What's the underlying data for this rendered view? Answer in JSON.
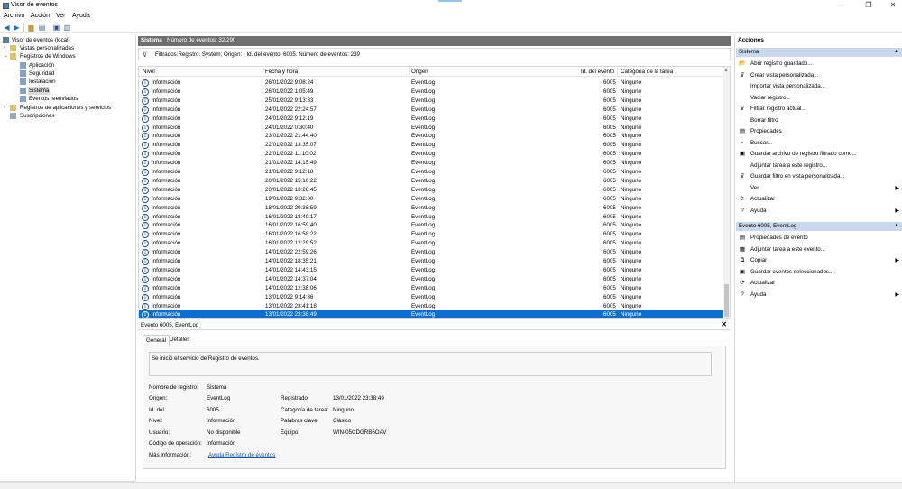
{
  "window": {
    "title": "Visor de eventos"
  },
  "menu": [
    "Archivo",
    "Acción",
    "Ver",
    "Ayuda"
  ],
  "window_controls": {
    "minimize": "—",
    "maximize": "❐",
    "close": "✕"
  },
  "tree": [
    {
      "label": "Visor de eventos (local)",
      "exp": "",
      "icon": "event-viewer-icon"
    },
    {
      "label": "Vistas personalizadas",
      "exp": "›",
      "icon": "folder-icon"
    },
    {
      "label": "Registros de Windows",
      "exp": "⌄",
      "icon": "folder-icon"
    },
    {
      "label": "Aplicación",
      "exp": "",
      "icon": "log-icon"
    },
    {
      "label": "Seguridad",
      "exp": "",
      "icon": "log-icon"
    },
    {
      "label": "Instalación",
      "exp": "",
      "icon": "log-icon"
    },
    {
      "label": "Sistema",
      "exp": "",
      "icon": "log-icon"
    },
    {
      "label": "Eventos reenviados",
      "exp": "",
      "icon": "log-icon"
    },
    {
      "label": "Registros de aplicaciones y servicios",
      "exp": "›",
      "icon": "folder-icon"
    },
    {
      "label": "Suscripciones",
      "exp": "",
      "icon": "subscription-icon"
    }
  ],
  "center": {
    "log_name": "Sistema",
    "event_count": "Número de eventos: 32.290",
    "filter_text": "Filtrados:Registro: System; Origen: ; Id. del evento: 6005. Número de eventos: 239"
  },
  "columns": [
    "Nivel",
    "Fecha y hora",
    "Origen",
    "Id. del evento",
    "Categoría de la tarea"
  ],
  "events": [
    {
      "level": "Información",
      "date": "26/01/2022 9:08:24",
      "source": "EventLog",
      "id": "6005",
      "category": "Ninguno"
    },
    {
      "level": "Información",
      "date": "26/01/2022 1:05:49",
      "source": "EventLog",
      "id": "6005",
      "category": "Ninguno"
    },
    {
      "level": "Información",
      "date": "25/01/2022 9:13:33",
      "source": "EventLog",
      "id": "6005",
      "category": "Ninguno"
    },
    {
      "level": "Información",
      "date": "24/01/2022 22:24:57",
      "source": "EventLog",
      "id": "6005",
      "category": "Ninguno"
    },
    {
      "level": "Información",
      "date": "24/01/2022 9:12:19",
      "source": "EventLog",
      "id": "6005",
      "category": "Ninguno"
    },
    {
      "level": "Información",
      "date": "24/01/2022 0:30:40",
      "source": "EventLog",
      "id": "6005",
      "category": "Ninguno"
    },
    {
      "level": "Información",
      "date": "23/01/2022 21:44:40",
      "source": "EventLog",
      "id": "6005",
      "category": "Ninguno"
    },
    {
      "level": "Información",
      "date": "22/01/2022 13:35:07",
      "source": "EventLog",
      "id": "6005",
      "category": "Ninguno"
    },
    {
      "level": "Información",
      "date": "22/01/2022 11:10:02",
      "source": "EventLog",
      "id": "6005",
      "category": "Ninguno"
    },
    {
      "level": "Información",
      "date": "21/01/2022 14:15:49",
      "source": "EventLog",
      "id": "6005",
      "category": "Ninguno"
    },
    {
      "level": "Información",
      "date": "21/01/2022 9:12:18",
      "source": "EventLog",
      "id": "6005",
      "category": "Ninguno"
    },
    {
      "level": "Información",
      "date": "20/01/2022 15:10:22",
      "source": "EventLog",
      "id": "6005",
      "category": "Ninguno"
    },
    {
      "level": "Información",
      "date": "20/01/2022 13:28:45",
      "source": "EventLog",
      "id": "6005",
      "category": "Ninguno"
    },
    {
      "level": "Información",
      "date": "19/01/2022 9:32:00",
      "source": "EventLog",
      "id": "6005",
      "category": "Ninguno"
    },
    {
      "level": "Información",
      "date": "18/01/2022 20:38:59",
      "source": "EventLog",
      "id": "6005",
      "category": "Ninguno"
    },
    {
      "level": "Información",
      "date": "16/01/2022 18:49:17",
      "source": "EventLog",
      "id": "6005",
      "category": "Ninguno"
    },
    {
      "level": "Información",
      "date": "16/01/2022 16:59:40",
      "source": "EventLog",
      "id": "6005",
      "category": "Ninguno"
    },
    {
      "level": "Información",
      "date": "16/01/2022 16:58:22",
      "source": "EventLog",
      "id": "6005",
      "category": "Ninguno"
    },
    {
      "level": "Información",
      "date": "16/01/2022 12:29:52",
      "source": "EventLog",
      "id": "6005",
      "category": "Ninguno"
    },
    {
      "level": "Información",
      "date": "14/01/2022 22:59:26",
      "source": "EventLog",
      "id": "6005",
      "category": "Ninguno"
    },
    {
      "level": "Información",
      "date": "14/01/2022 18:35:21",
      "source": "EventLog",
      "id": "6005",
      "category": "Ninguno"
    },
    {
      "level": "Información",
      "date": "14/01/2022 14:43:15",
      "source": "EventLog",
      "id": "6005",
      "category": "Ninguno"
    },
    {
      "level": "Información",
      "date": "14/01/2022 14:37:04",
      "source": "EventLog",
      "id": "6005",
      "category": "Ninguno"
    },
    {
      "level": "Información",
      "date": "14/01/2022 12:38:06",
      "source": "EventLog",
      "id": "6005",
      "category": "Ninguno"
    },
    {
      "level": "Información",
      "date": "13/01/2022 9:14:36",
      "source": "EventLog",
      "id": "6005",
      "category": "Ninguno"
    },
    {
      "level": "Información",
      "date": "13/01/2022 23:41:18",
      "source": "EventLog",
      "id": "6005",
      "category": "Ninguno"
    },
    {
      "level": "Información",
      "date": "13/01/2022 23:38:49",
      "source": "EventLog",
      "id": "6005",
      "category": "Ninguno",
      "selected": true
    }
  ],
  "detail": {
    "title": "Evento 6005, EventLog",
    "close": "✕",
    "tabs": [
      "General",
      "Detalles"
    ],
    "description": "Se inició el servicio de Registro de eventos.",
    "fields": {
      "log_name_label": "Nombre de registro:",
      "log_name": "Sistema",
      "source_label": "Origen:",
      "source": "EventLog",
      "logged_label": "Registrado:",
      "logged": "13/01/2022 23:38:49",
      "id_label": "Id. del",
      "id": "6005",
      "category_label": "Categoría de tarea:",
      "category": "Ninguno",
      "level_label": "Nivel:",
      "level": "Información",
      "keywords_label": "Palabras clave:",
      "keywords": "Clásico",
      "user_label": "Usuario:",
      "user": "No disponible",
      "computer_label": "Equipo:",
      "computer": "WIN-05CDGRB6OAV",
      "opcode_label": "Código de operación:",
      "opcode": "Información",
      "more_info_label": "Más información:",
      "more_info": "Ayuda Registro de eventos"
    }
  },
  "actions": {
    "title": "Acciones",
    "section1": {
      "header": "Sistema",
      "items": [
        {
          "label": "Abrir registro guardado...",
          "icon": "open-icon",
          "glyph": "📂"
        },
        {
          "label": "Crear vista personalizada...",
          "icon": "filter-add-icon",
          "glyph": "⊽"
        },
        {
          "label": "Importar vista personalizada...",
          "icon": "import-icon",
          "glyph": ""
        },
        {
          "label": "Vaciar registro...",
          "icon": "clear-icon",
          "glyph": ""
        },
        {
          "label": "Filtrar registro actual...",
          "icon": "filter-icon",
          "glyph": "⊽"
        },
        {
          "label": "Borrar filtro",
          "icon": "clear-filter-icon",
          "glyph": ""
        },
        {
          "label": "Propiedades",
          "icon": "properties-icon",
          "glyph": "▤"
        },
        {
          "label": "Buscar...",
          "icon": "find-icon",
          "glyph": "⌕"
        },
        {
          "label": "Guardar archivo de registro filtrado como...",
          "icon": "save-icon",
          "glyph": "▣"
        },
        {
          "label": "Adjuntar tarea a este registro...",
          "icon": "attach-task-icon",
          "glyph": ""
        },
        {
          "label": "Guardar filtro en vista personalizada...",
          "icon": "save-filter-icon",
          "glyph": "⊽"
        },
        {
          "label": "Ver",
          "icon": "view-icon",
          "glyph": "",
          "submenu": true
        },
        {
          "label": "Actualizar",
          "icon": "refresh-icon",
          "glyph": "⟳"
        },
        {
          "label": "Ayuda",
          "icon": "help-icon",
          "glyph": "?",
          "submenu": true
        }
      ]
    },
    "section2": {
      "header": "Evento 6005, EventLog",
      "items": [
        {
          "label": "Propiedades de evento",
          "icon": "event-properties-icon",
          "glyph": "▤"
        },
        {
          "label": "Adjuntar tarea a este evento...",
          "icon": "attach-task-icon",
          "glyph": "▦"
        },
        {
          "label": "Copiar",
          "icon": "copy-icon",
          "glyph": "⧉",
          "submenu": true
        },
        {
          "label": "Guardar eventos seleccionados...",
          "icon": "save-icon",
          "glyph": "▣"
        },
        {
          "label": "Actualizar",
          "icon": "refresh-icon",
          "glyph": "⟳"
        },
        {
          "label": "Ayuda",
          "icon": "help-icon",
          "glyph": "?",
          "submenu": true
        }
      ]
    }
  }
}
